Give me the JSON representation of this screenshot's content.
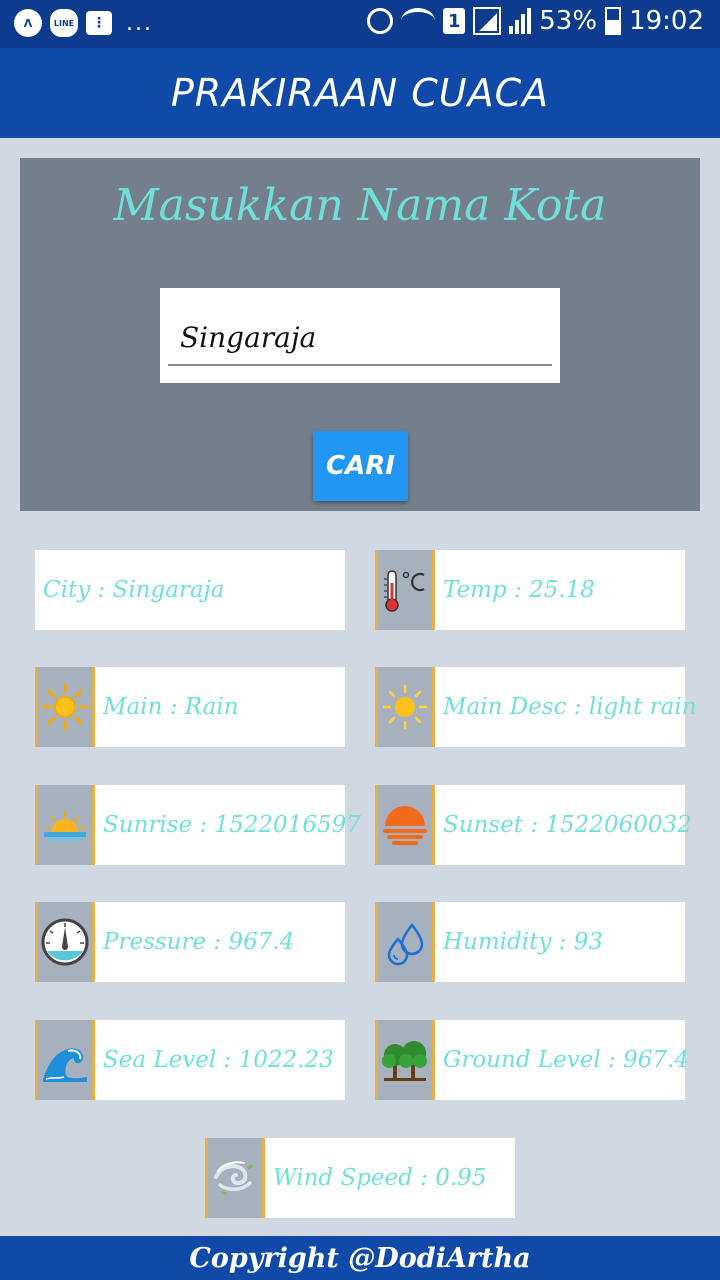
{
  "status_bar": {
    "left_icons": [
      "app-a-icon",
      "line-icon",
      "bbm-icon"
    ],
    "line_label": "LINE",
    "more": "...",
    "sim": "1",
    "battery_percent": "53%",
    "time": "19:02"
  },
  "app": {
    "title": "PRAKIRAAN CUACA"
  },
  "search": {
    "heading": "Masukkan Nama Kota",
    "city_value": "Singaraja",
    "button_label": "CARI"
  },
  "weather": {
    "city": "City : Singaraja",
    "temp": "Temp : 25.18",
    "main": "Main : Rain",
    "main_desc": "Main Desc : light rain",
    "sunrise": "Sunrise : 1522016597",
    "sunset": "Sunset : 1522060032",
    "pressure": "Pressure : 967.4",
    "humidity": "Humidity : 93",
    "sea_level": "Sea Level : 1022.23",
    "ground_level": "Ground Level : 967.4",
    "wind_speed": "Wind Speed : 0.95"
  },
  "footer": {
    "copyright": "Copyright @DodiArtha"
  },
  "colors": {
    "status_bar": "#0d3c8f",
    "app_bar": "#0f4aa8",
    "background": "#d1d8e2",
    "panel": "#757e8b",
    "accent_text": "#6fe0d8",
    "button": "#2196f3",
    "icon_cell": "#a7b0bd",
    "icon_border": "#e8b040"
  }
}
